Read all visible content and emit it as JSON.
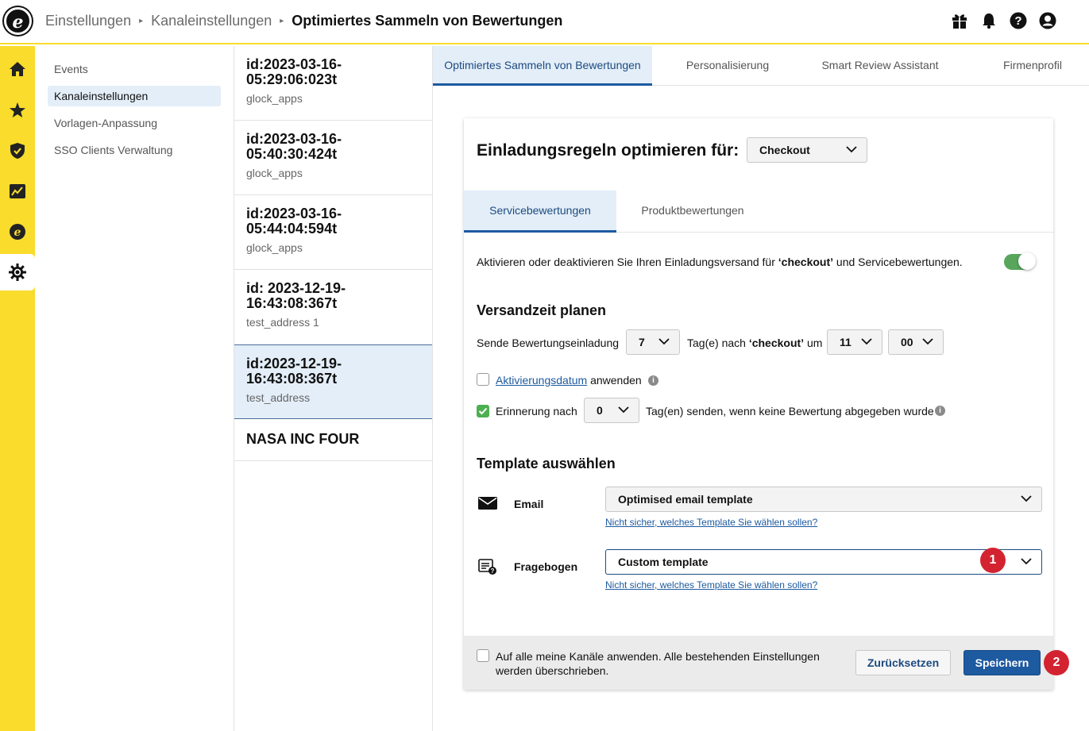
{
  "colors": {
    "brand_yellow": "#f9dc2c",
    "primary": "#1d5aa0",
    "active_bg": "#e3eef8",
    "toggle_on": "#58a65c",
    "badge": "#d32330"
  },
  "header": {
    "logo": "e",
    "breadcrumb": [
      "Einstellungen",
      "Kanaleinstellungen",
      "Optimiertes Sammeln von Bewertungen"
    ],
    "icons": [
      "gift-icon",
      "bell-icon",
      "help-icon",
      "user-icon"
    ]
  },
  "rail": {
    "items": [
      "home-icon",
      "star-icon",
      "shield-icon",
      "analytics-icon",
      "etrusted-icon",
      "settings-icon"
    ],
    "active": "settings-icon"
  },
  "subnav": {
    "items": [
      "Events",
      "Kanaleinstellungen",
      "Vorlagen-Anpassung",
      "SSO Clients Verwaltung"
    ],
    "active": "Kanaleinstellungen"
  },
  "channels": [
    {
      "title": "id:2023-03-16-05:29:06:023t",
      "sub": "glock_apps"
    },
    {
      "title": "id:2023-03-16-05:40:30:424t",
      "sub": "glock_apps"
    },
    {
      "title": "id:2023-03-16-05:44:04:594t",
      "sub": "glock_apps"
    },
    {
      "title": "id: 2023-12-19-16:43:08:367t",
      "sub": "test_address 1"
    },
    {
      "title": "id:2023-12-19-16:43:08:367t",
      "sub": "test_address"
    },
    {
      "title": "NASA INC FOUR",
      "sub": ""
    }
  ],
  "active_channel_index": 4,
  "main_tabs": [
    "Optimiertes Sammeln von Bewertungen",
    "Personalisierung",
    "Smart Review Assistant",
    "Firmenprofil"
  ],
  "card": {
    "title": "Einladungsregeln optimieren für:",
    "event_select": "Checkout",
    "subtabs": [
      "Servicebewertungen",
      "Produktbewertungen"
    ],
    "toggle": {
      "text_before": "Aktivieren oder deaktivieren Sie Ihren Einladungsversand für ",
      "text_bold": "‘checkout’",
      "text_after": " und Servicebewertungen.",
      "enabled": true
    },
    "schedule": {
      "heading": "Versandzeit planen",
      "label_send": "Sende Bewertungseinladung",
      "days": "7",
      "label_after_before": "Tag(e) nach ",
      "label_after_bold": "‘checkout’",
      "label_after_end": " um",
      "hour": "11",
      "minute": "00",
      "activation_checked": false,
      "activation_link": "Aktivierungsdatum",
      "activation_text": "anwenden",
      "reminder_checked": true,
      "reminder_label": "Erinnerung nach",
      "reminder_days": "0",
      "reminder_text": "Tag(en) senden, wenn keine Bewertung abgegeben wurde"
    },
    "templates": {
      "heading": "Template auswählen",
      "email_label": "Email",
      "email_value": "Optimised email template",
      "email_help": "Nicht sicher, welches Template Sie wählen sollen?",
      "survey_label": "Fragebogen",
      "survey_value": "Custom template",
      "survey_help": "Nicht sicher, welches Template Sie wählen sollen?"
    },
    "footer": {
      "apply_all_checked": false,
      "apply_all_text": "Auf alle meine Kanäle anwenden. Alle bestehenden Einstellungen werden überschrieben.",
      "reset": "Zurücksetzen",
      "save": "Speichern"
    }
  },
  "badges": [
    "1",
    "2"
  ]
}
